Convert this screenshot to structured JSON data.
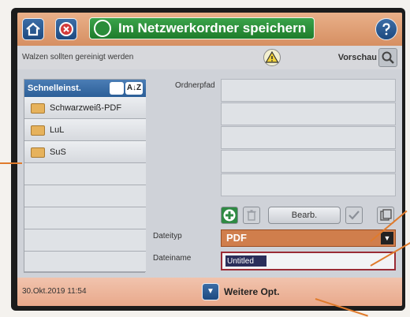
{
  "header": {
    "title": "Im Netzwerkordner speichern",
    "home_icon": "home-icon",
    "stop_icon": "stop-icon",
    "help_icon": "help-icon"
  },
  "status": {
    "message": "Walzen sollten gereinigt werden",
    "preview_label": "Vorschau",
    "warning_icon": "warning-icon"
  },
  "quickset": {
    "title": "Schnelleinst.",
    "sort_label": "A↓Z",
    "items": [
      {
        "label": "Schwarzweiß-PDF",
        "icon": "folder-icon"
      },
      {
        "label": "LuL",
        "icon": "folder-icon"
      },
      {
        "label": "SuS",
        "icon": "folder-icon"
      }
    ]
  },
  "form": {
    "folder_path_label": "Ordnerpfad",
    "edit_button": "Bearb.",
    "file_type_label": "Dateityp",
    "file_type_value": "PDF",
    "file_name_label": "Dateiname",
    "file_name_value": "Untitled"
  },
  "footer": {
    "datetime": "30.Okt.2019 11:54",
    "more_options": "Weitere Opt."
  },
  "colors": {
    "header": "#d68f62",
    "title_green": "#1e7c2b",
    "accent_blue": "#2c5f98",
    "file_type_orange": "#d07e4c",
    "file_name_border": "#9a2b35",
    "footer": "#e9a98b",
    "annotation": "#e07b2c"
  }
}
